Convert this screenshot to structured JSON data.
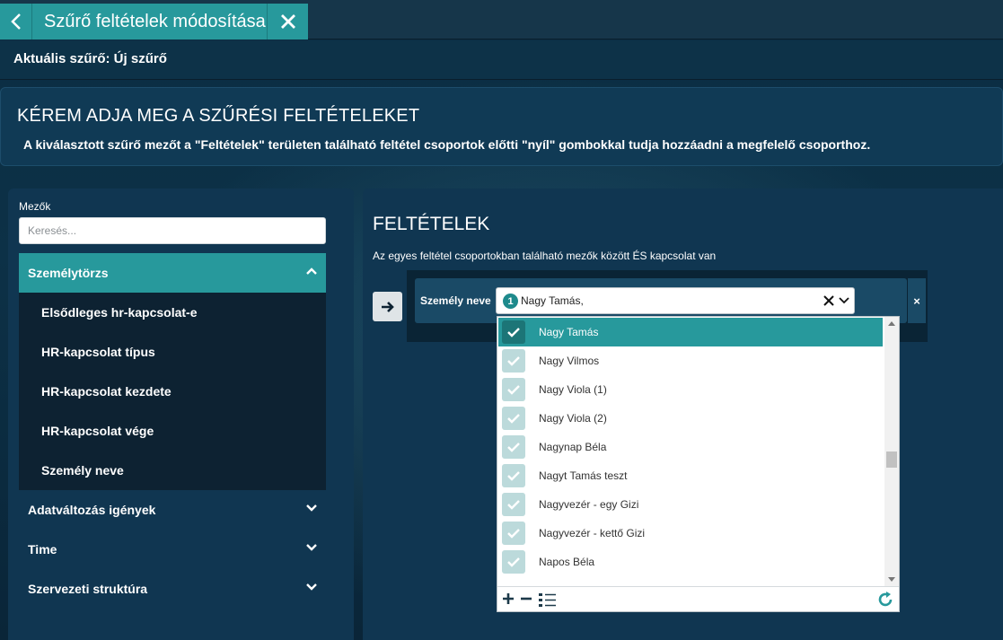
{
  "header": {
    "title": "Szűrő feltételek módosítása"
  },
  "subheader": {
    "text": "Aktuális szűrő: Új szűrő"
  },
  "banner": {
    "heading": "KÉREM ADJA MEG A SZŰRÉSI FELTÉTELEKET",
    "description": "A kiválasztott szűrő mezőt a \"Feltételek\" területen található feltétel csoportok előtti \"nyíl\" gombokkal tudja hozzáadni a megfelelő csoporthoz."
  },
  "left": {
    "label": "Mezők",
    "search_placeholder": "Keresés...",
    "groups": [
      {
        "label": "Személytörzs",
        "open": true
      },
      {
        "label": "Adatváltozás igények",
        "open": false
      },
      {
        "label": "Time",
        "open": false
      },
      {
        "label": "Szervezeti struktúra",
        "open": false
      }
    ],
    "subitems": [
      "Elsődleges hr-kapcsolat-e",
      "HR-kapcsolat típus",
      "HR-kapcsolat kezdete",
      "HR-kapcsolat vége",
      "Személy neve"
    ]
  },
  "right": {
    "title": "FELTÉTELEK",
    "description": "Az egyes feltétel csoportokban található mezők között ÉS kapcsolat van",
    "field_label": "Személy neve",
    "remove_label": "×",
    "select": {
      "count": "1",
      "value": "Nagy Tamás,"
    },
    "options": [
      {
        "label": "Nagy Tamás",
        "selected": true
      },
      {
        "label": "Nagy Vilmos",
        "selected": false
      },
      {
        "label": "Nagy Viola (1)",
        "selected": false
      },
      {
        "label": "Nagy Viola (2)",
        "selected": false
      },
      {
        "label": "Nagynap Béla",
        "selected": false
      },
      {
        "label": "Nagyt Tamás teszt",
        "selected": false
      },
      {
        "label": "Nagyvezér - egy Gizi",
        "selected": false
      },
      {
        "label": "Nagyvezér - kettő Gizi",
        "selected": false
      },
      {
        "label": "Napos Béla",
        "selected": false
      }
    ]
  },
  "colors": {
    "accent": "#27999c",
    "panel": "#103651",
    "dark": "#0d2232"
  }
}
